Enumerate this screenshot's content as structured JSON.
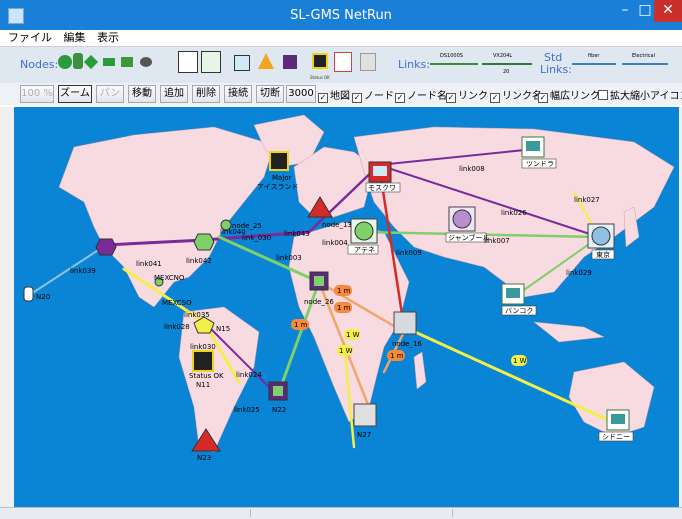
{
  "window": {
    "title": "SL-GMS NetRun",
    "minimize": "–",
    "maximize": "□",
    "close": "✕"
  },
  "menu": [
    "ファイル",
    "編集",
    "表示"
  ],
  "toolbar1": {
    "nodes_label": "Nodes:",
    "links_label": "Links:",
    "std_label": "Std",
    "links2_label": "Links:",
    "link_types": [
      "DS1000S",
      "VX204L",
      "20",
      "fiber",
      "Electrical"
    ],
    "status_label": "Status OK"
  },
  "toolbar2": {
    "buttons": [
      "100 %",
      "ズーム",
      "パン",
      "移動",
      "追加",
      "削除",
      "接続",
      "切断",
      "3000"
    ],
    "checkboxes": [
      {
        "label": "地図",
        "checked": true
      },
      {
        "label": "ノード",
        "checked": true
      },
      {
        "label": "ノード名",
        "checked": true
      },
      {
        "label": "リンク",
        "checked": true
      },
      {
        "label": "リンク名",
        "checked": true
      },
      {
        "label": "幅広リンク",
        "checked": true
      },
      {
        "label": "拡大縮小アイコン",
        "checked": false
      }
    ]
  },
  "map": {
    "nodes": [
      "モスクワ",
      "ツンドラ",
      "アテネ",
      "ジャンブール",
      "東京",
      "バンコク",
      "シドニー",
      "N20",
      "N15",
      "N11",
      "N22",
      "N23",
      "N27",
      "node_26",
      "node_16",
      "node_13",
      "node_25",
      "アイスランド",
      "MEXCNO",
      "MEXCSO"
    ],
    "links": [
      "link008",
      "link027",
      "link026",
      "link007",
      "link009",
      "link029",
      "link004",
      "link003",
      "link043",
      "link040",
      "link041",
      "link042",
      "link039",
      "link035",
      "link030",
      "link024",
      "link025",
      "link028",
      "link_030"
    ],
    "badges": [
      "1 m",
      "1 m",
      "1 m",
      "1 m",
      "1 W",
      "1 W",
      "1 W"
    ],
    "labels": {
      "major": "Major",
      "iceland": "アイスランド",
      "status_ok": "Status OK"
    },
    "colors": {
      "sea": "#0a84d4",
      "land": "#f7dbe1",
      "purple": "#7b2a9a",
      "green": "#7fd06a",
      "yellow": "#f3ef4a",
      "red": "#d62a2a",
      "orange": "#f2a56a",
      "lightblue": "#8ec0e0"
    }
  }
}
